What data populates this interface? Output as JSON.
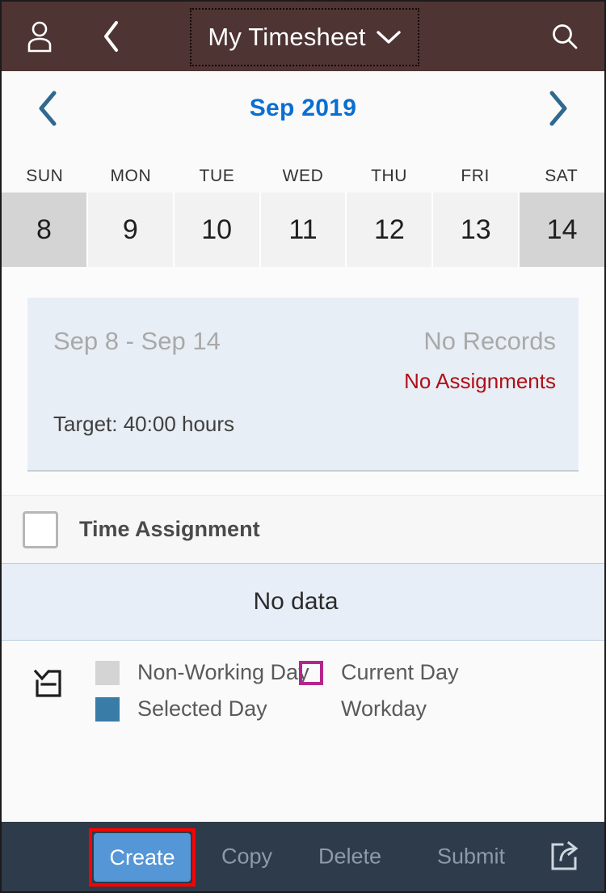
{
  "header": {
    "profile_icon": "person-icon",
    "back_icon": "chevron-left-icon",
    "title": "My Timesheet",
    "title_dropdown_icon": "chevron-down-icon",
    "search_icon": "search-icon",
    "background_color": "#4f3434"
  },
  "month_nav": {
    "prev_icon": "chevron-left-icon",
    "label": "Sep 2019",
    "next_icon": "chevron-right-icon",
    "accent_color": "#0a6ed1"
  },
  "calendar": {
    "weekdays": [
      "SUN",
      "MON",
      "TUE",
      "WED",
      "THU",
      "FRI",
      "SAT"
    ],
    "days": [
      {
        "num": "8",
        "nonworking": true
      },
      {
        "num": "9",
        "nonworking": false
      },
      {
        "num": "10",
        "nonworking": false
      },
      {
        "num": "11",
        "nonworking": false
      },
      {
        "num": "12",
        "nonworking": false
      },
      {
        "num": "13",
        "nonworking": false
      },
      {
        "num": "14",
        "nonworking": true
      }
    ]
  },
  "summary": {
    "date_range": "Sep 8 - Sep 14",
    "records": "No Records",
    "assignments": "No Assignments",
    "assignments_color": "#b00f18",
    "target": "Target: 40:00 hours",
    "background_color": "#e8eef5"
  },
  "time_assignment": {
    "checkbox_checked": false,
    "label": "Time Assignment"
  },
  "table": {
    "empty_text": "No data"
  },
  "legend": {
    "collapse_icon": "collapse-group-icon",
    "items": [
      {
        "label": "Non-Working Day",
        "swatch": "solid-gray",
        "color": "#d4d4d4"
      },
      {
        "label": "Current Day",
        "swatch": "outline-magenta",
        "color": "#b5268c"
      },
      {
        "label": "Selected Day",
        "swatch": "solid-blue",
        "color": "#3a7ca8"
      },
      {
        "label": "Workday",
        "swatch": "blank",
        "color": "#ffffff"
      }
    ]
  },
  "footer": {
    "create": {
      "label": "Create",
      "enabled": true,
      "highlighted": true,
      "color": "#5596d6"
    },
    "copy": {
      "label": "Copy",
      "enabled": false
    },
    "delete": {
      "label": "Delete",
      "enabled": false
    },
    "submit": {
      "label": "Submit",
      "enabled": false
    },
    "share_icon": "share-export-icon",
    "background_color": "#2e3b4a",
    "annotation_color": "#ff0000"
  }
}
